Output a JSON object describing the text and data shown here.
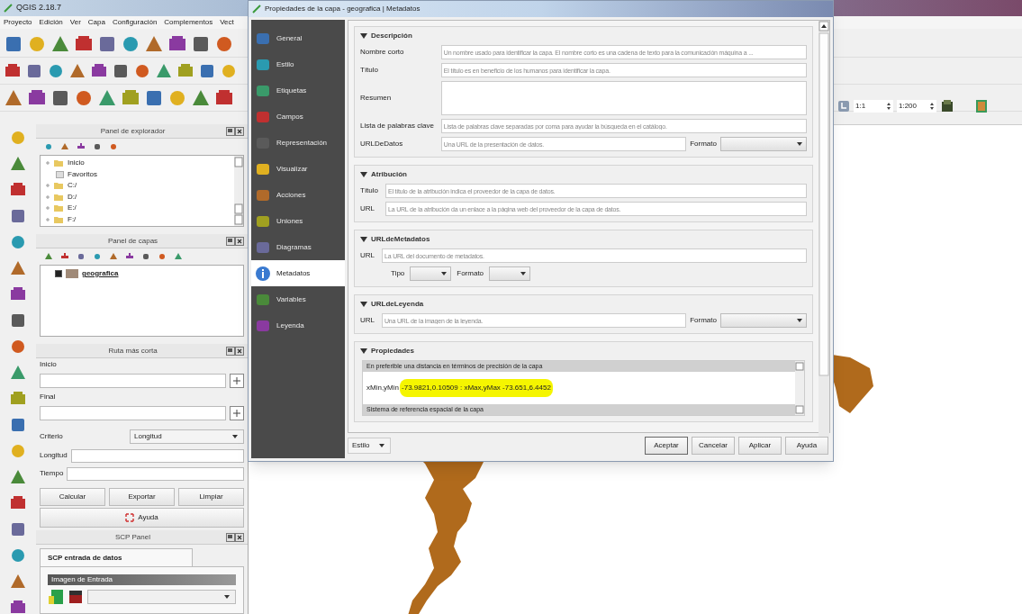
{
  "window": {
    "title": "QGIS 2.18.7"
  },
  "menu": [
    "Proyecto",
    "Edición",
    "Ver",
    "Capa",
    "Configuración",
    "Complementos",
    "Vect"
  ],
  "browser_panel": {
    "title": "Panel de explorador",
    "items": [
      {
        "label": "Inicio",
        "kind": "folder"
      },
      {
        "label": "Favoritos",
        "kind": "favorites"
      },
      {
        "label": "C:/",
        "kind": "folder"
      },
      {
        "label": "D:/",
        "kind": "folder"
      },
      {
        "label": "E:/",
        "kind": "folder"
      },
      {
        "label": "F:/",
        "kind": "folder"
      }
    ]
  },
  "layers_panel": {
    "title": "Panel de capas",
    "layers": [
      {
        "name": "geografica",
        "checked": true,
        "color": "#a08a78"
      }
    ]
  },
  "shortest_path_panel": {
    "title": "Ruta más corta",
    "start_label": "Inicio",
    "end_label": "Final",
    "criterion_label": "Criterio",
    "criterion": "Longitud",
    "length_label": "Longitud",
    "time_label": "Tiempo",
    "buttons": [
      "Calcular",
      "Exportar",
      "Limpiar"
    ],
    "help": "Ayuda"
  },
  "scp_panel": {
    "title": "SCP Panel",
    "tab": "SCP entrada de datos",
    "input_image": "Imagen de Entrada"
  },
  "scale_toolbar": {
    "rotation": "1:1",
    "scale": "1:200"
  },
  "dialog": {
    "title": "Propiedades de la capa - geografica | Metadatos",
    "nav": [
      {
        "label": "General",
        "selected": false
      },
      {
        "label": "Estilo",
        "selected": false
      },
      {
        "label": "Etiquetas",
        "selected": false
      },
      {
        "label": "Campos",
        "selected": false
      },
      {
        "label": "Representación",
        "selected": false
      },
      {
        "label": "Visualizar",
        "selected": false
      },
      {
        "label": "Acciones",
        "selected": false
      },
      {
        "label": "Uniones",
        "selected": false
      },
      {
        "label": "Diagramas",
        "selected": false
      },
      {
        "label": "Metadatos",
        "selected": true
      },
      {
        "label": "Variables",
        "selected": false
      },
      {
        "label": "Leyenda",
        "selected": false
      }
    ],
    "sections": [
      {
        "title": "Descripción",
        "expanded": true,
        "rows": [
          {
            "kind": "field",
            "label": "Nombre corto",
            "placeholder": "Un nombre usado para identificar la capa. El nombre corto es una cadena de texto para la comunicación máquina a ..."
          },
          {
            "kind": "field",
            "label": "Título",
            "placeholder": "El título es en beneficio de los humanos para identificar la capa."
          },
          {
            "kind": "textarea",
            "label": "Resumen"
          },
          {
            "kind": "field",
            "label": "Lista de palabras clave",
            "placeholder": "Lista de palabras clave separadas por coma para ayudar la búsqueda en el catálogo."
          },
          {
            "kind": "field",
            "label": "URLDeDatos",
            "placeholder": "Una URL de la presentación de datos.",
            "format_label": "Formato"
          }
        ]
      },
      {
        "title": "Atribución",
        "expanded": true,
        "rows": [
          {
            "kind": "field",
            "label": "Título",
            "placeholder": "El título de la atribución indica el proveedor de la capa de datos."
          },
          {
            "kind": "field",
            "label": "URL",
            "placeholder": "La URL de la atribución da un enlace a la página web del proveedor de la capa de datos."
          }
        ]
      },
      {
        "title": "URLdeMetadatos",
        "expanded": true,
        "rows": [
          {
            "kind": "field",
            "label": "URL",
            "placeholder": "La URL del documento de metadatos."
          },
          {
            "kind": "combos",
            "items": [
              "Tipo",
              "Formato"
            ]
          }
        ]
      },
      {
        "title": "URLdeLeyenda",
        "expanded": true,
        "rows": [
          {
            "kind": "field",
            "label": "URL",
            "placeholder": "Una URL de la imagen de la leyenda.",
            "format_label": "Formato"
          }
        ]
      },
      {
        "title": "Propiedades",
        "expanded": true,
        "rows": [
          {
            "kind": "list",
            "items": [
              {
                "kind": "header",
                "text": "En preferible una distancia en términos de precisión de la capa"
              },
              {
                "kind": "extent",
                "prefix": "xMin,yMin",
                "value": "-73.9821,0.10509 : xMax,yMax -73.651,6.4452",
                "highlighted": true
              },
              {
                "kind": "header",
                "text": "Sistema de referencia espacial de la capa"
              }
            ]
          }
        ]
      }
    ],
    "style_button": "Estilo",
    "buttons": [
      "Aceptar",
      "Cancelar",
      "Aplicar",
      "Ayuda"
    ]
  }
}
